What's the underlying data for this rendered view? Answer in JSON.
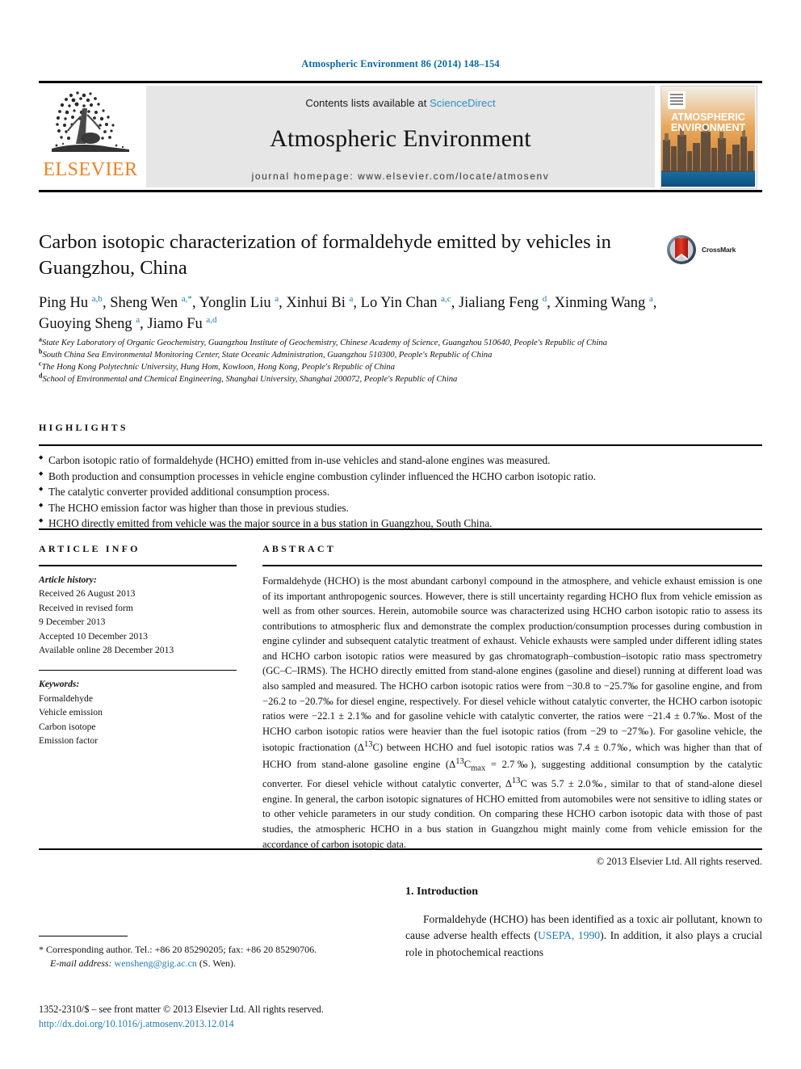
{
  "running_head": "Atmospheric Environment 86 (2014) 148–154",
  "masthead": {
    "publisher_name": "ELSEVIER",
    "contents_prefix": "Contents lists available at ",
    "contents_link": "ScienceDirect",
    "journal_name": "Atmospheric Environment",
    "homepage": "journal homepage: www.elsevier.com/locate/atmosenv",
    "cover_line1": "ATMOSPHERIC",
    "cover_line2": "ENVIRONMENT"
  },
  "title": "Carbon isotopic characterization of formaldehyde emitted by vehicles in Guangzhou, China",
  "crossmark_label": "CrossMark",
  "authors_html": "Ping Hu <sup>a,b</sup>, Sheng Wen <sup>a,*</sup>, Yonglin Liu <sup>a</sup>, Xinhui Bi <sup>a</sup>, Lo Yin Chan <sup>a,c</sup>, Jialiang Feng <sup>d</sup>, Xinming Wang <sup>a</sup>, Guoying Sheng <sup>a</sup>, Jiamo Fu <sup>a,d</sup>",
  "affiliations": [
    {
      "marker": "a",
      "text": "State Key Laboratory of Organic Geochemistry, Guangzhou Institute of Geochemistry, Chinese Academy of Science, Guangzhou 510640, People's Republic of China"
    },
    {
      "marker": "b",
      "text": "South China Sea Environmental Monitoring Center, State Oceanic Administration, Guangzhou 510300, People's Republic of China"
    },
    {
      "marker": "c",
      "text": "The Hong Kong Polytechnic University, Hung Hom, Kowloon, Hong Kong, People's Republic of China"
    },
    {
      "marker": "d",
      "text": "School of Environmental and Chemical Engineering, Shanghai University, Shanghai 200072, People's Republic of China"
    }
  ],
  "highlights": {
    "label": "HIGHLIGHTS",
    "items": [
      "Carbon isotopic ratio of formaldehyde (HCHO) emitted from in-use vehicles and stand-alone engines was measured.",
      "Both production and consumption processes in vehicle engine combustion cylinder influenced the HCHO carbon isotopic ratio.",
      "The catalytic converter provided additional consumption process.",
      "The HCHO emission factor was higher than those in previous studies.",
      "HCHO directly emitted from vehicle was the major source in a bus station in Guangzhou, South China."
    ]
  },
  "article_info": {
    "label": "ARTICLE INFO",
    "history_label": "Article history:",
    "history_lines": [
      "Received 26 August 2013",
      "Received in revised form",
      "9 December 2013",
      "Accepted 10 December 2013",
      "Available online 28 December 2013"
    ],
    "keywords_label": "Keywords:",
    "keywords": [
      "Formaldehyde",
      "Vehicle emission",
      "Carbon isotope",
      "Emission factor"
    ]
  },
  "abstract": {
    "label": "ABSTRACT",
    "body_html": "Formaldehyde (HCHO) is the most abundant carbonyl compound in the atmosphere, and vehicle exhaust emission is one of its important anthropogenic sources. However, there is still uncertainty regarding HCHO flux from vehicle emission as well as from other sources. Herein, automobile source was characterized using HCHO carbon isotopic ratio to assess its contributions to atmospheric flux and demonstrate the complex production/consumption processes during combustion in engine cylinder and subsequent catalytic treatment of exhaust. Vehicle exhausts were sampled under different idling states and HCHO carbon isotopic ratios were measured by gas chromatograph–combustion–isotopic ratio mass spectrometry (GC–C–IRMS). The HCHO directly emitted from stand-alone engines (gasoline and diesel) running at different load was also sampled and measured. The HCHO carbon isotopic ratios were from −30.8 to −25.7‰ for gasoline engine, and from −26.2 to −20.7‰ for diesel engine, respectively. For diesel vehicle without catalytic converter, the HCHO carbon isotopic ratios were −22.1 ± 2.1‰ and for gasoline vehicle with catalytic converter, the ratios were −21.4 ± 0.7‰. Most of the HCHO carbon isotopic ratios were heavier than the fuel isotopic ratios (from −29 to −27‰). For gasoline vehicle, the isotopic fractionation (Δ<sup>13</sup>C) between HCHO and fuel isotopic ratios was 7.4 ± 0.7‰, which was higher than that of HCHO from stand-alone gasoline engine (Δ<sup>13</sup>C<sub>max</sub> = 2.7‰), suggesting additional consumption by the catalytic converter. For diesel vehicle without catalytic converter, Δ<sup>13</sup>C was 5.7 ± 2.0‰, similar to that of stand-alone diesel engine. In general, the carbon isotopic signatures of HCHO emitted from automobiles were not sensitive to idling states or to other vehicle parameters in our study condition. On comparing these HCHO carbon isotopic data with those of past studies, the atmospheric HCHO in a bus station in Guangzhou might mainly come from vehicle emission for the accordance of carbon isotopic data.",
    "copyright": "© 2013 Elsevier Ltd. All rights reserved."
  },
  "introduction": {
    "heading": "1. Introduction",
    "paragraph_html": "Formaldehyde (HCHO) has been identified as a toxic air pollutant, known to cause adverse health effects (<span class=\"link\">USEPA, 1990</span>). In addition, it also plays a crucial role in photochemical reactions"
  },
  "footnote": {
    "corresponding": "* Corresponding author. Tel.: +86 20 85290205; fax: +86 20 85290706.",
    "email_label": "E-mail address:",
    "email": "wensheng@gig.ac.cn",
    "email_suffix": "(S. Wen)."
  },
  "colophon": {
    "issn_line": "1352-2310/$ – see front matter © 2013 Elsevier Ltd. All rights reserved.",
    "doi": "http://dx.doi.org/10.1016/j.atmosenv.2013.12.014"
  },
  "colors": {
    "link": "#1b7bb0",
    "elsevier_orange": "#ec8321",
    "banner_gray": "#e6e6e6",
    "sciencedirect_blue": "#2b8dc4"
  }
}
